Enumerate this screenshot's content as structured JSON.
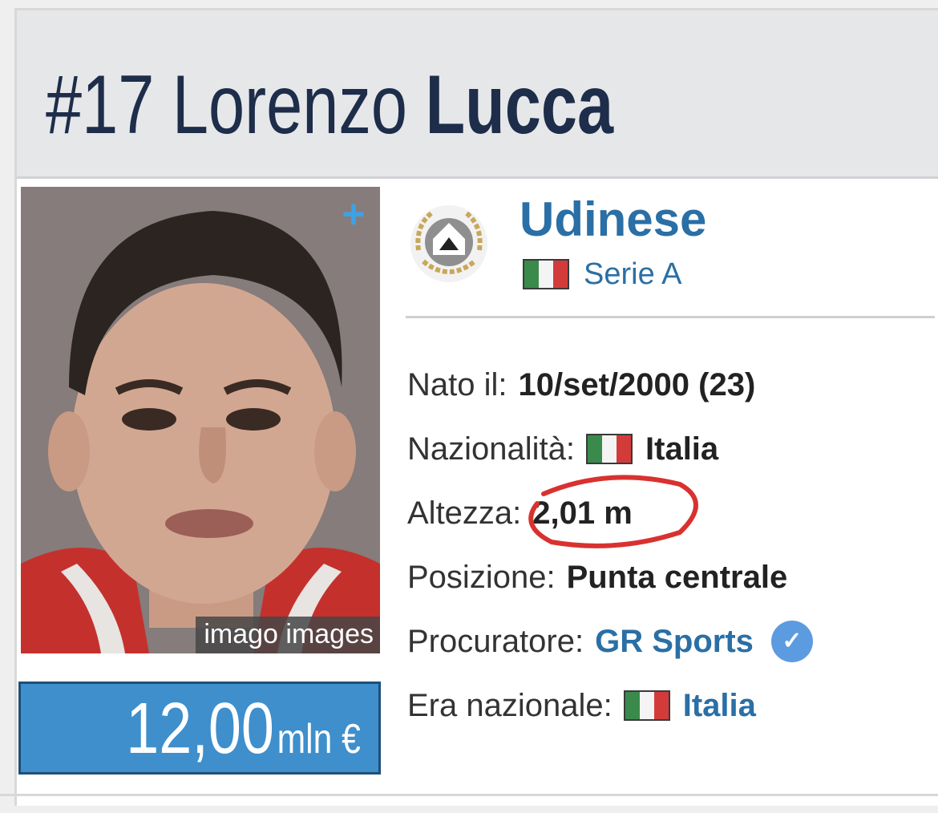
{
  "player": {
    "number": "#17",
    "first_name": "Lorenzo",
    "last_name": "Lucca"
  },
  "photo": {
    "credit": "imago images",
    "expand_icon": "plus-icon"
  },
  "market_value": {
    "amount": "12,00",
    "unit": "mln €"
  },
  "club": {
    "name": "Udinese",
    "league": "Serie A",
    "logo_icon": "club-crest-icon"
  },
  "details": {
    "birth_label": "Nato il:",
    "birth_value": "10/set/2000 (23)",
    "nationality_label": "Nazionalità:",
    "nationality_value": "Italia",
    "height_label": "Altezza:",
    "height_value": "2,01 m",
    "position_label": "Posizione:",
    "position_value": "Punta centrale",
    "agent_label": "Procuratore:",
    "agent_value": "GR Sports",
    "national_label": "Era nazionale:",
    "national_value": "Italia"
  },
  "colors": {
    "title": "#1d2d4a",
    "link": "#2a6fa5",
    "value_box": "#3e8fcc",
    "annotation": "#d8322f"
  }
}
